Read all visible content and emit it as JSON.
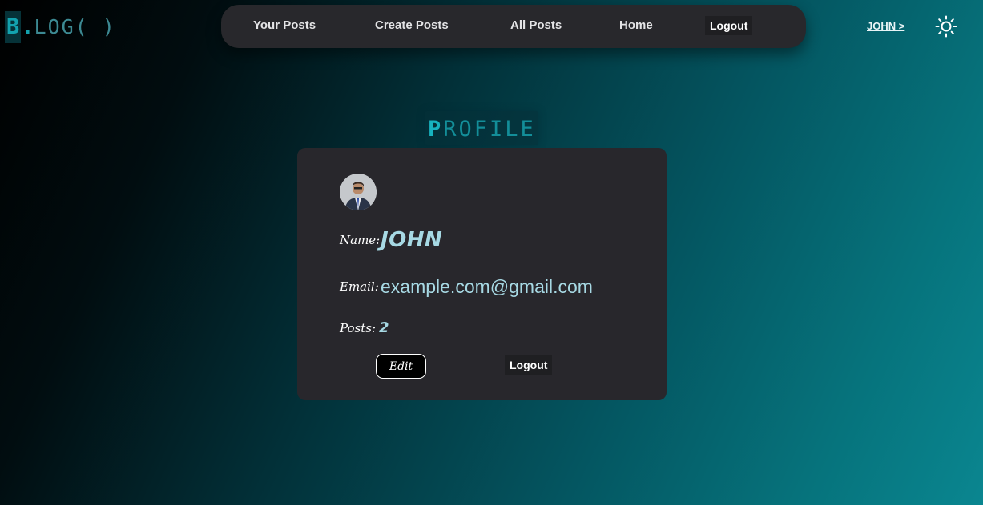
{
  "logo": {
    "first": "B",
    "dot": ".",
    "rest": "LOG( )"
  },
  "nav": {
    "items": [
      "Your Posts",
      "Create Posts",
      "All Posts",
      "Home"
    ],
    "logout": "Logout"
  },
  "user": {
    "link": "JOHN >"
  },
  "theme_icon": "sun-icon",
  "profile": {
    "heading_first": "P",
    "heading_rest": "ROFILE",
    "name_label": "Name:",
    "name": "JOHN",
    "email_label": "Email:",
    "email": "example.com@gmail.com",
    "posts_label": "Posts:",
    "posts": "2",
    "edit": "Edit",
    "logout": "Logout"
  },
  "colors": {
    "accent": "#13a2ae",
    "card_bg": "#28272c",
    "value_text": "#a7d9e4"
  }
}
